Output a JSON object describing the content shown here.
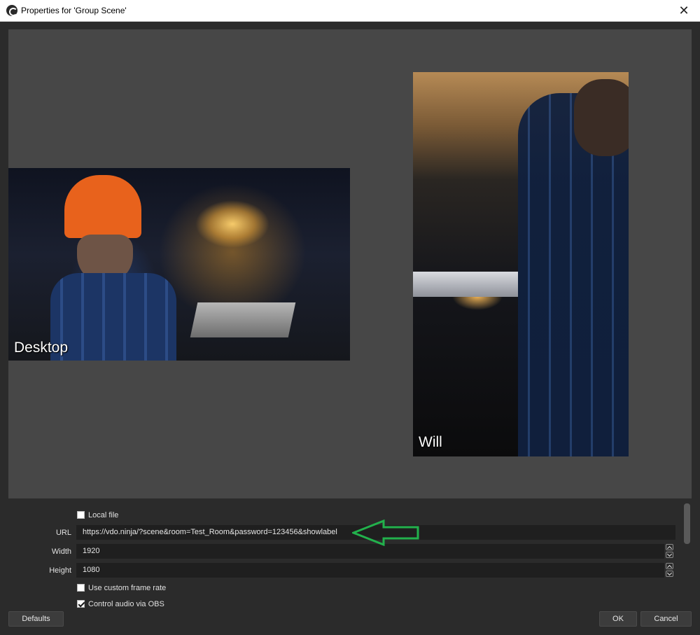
{
  "window": {
    "title": "Properties for 'Group Scene'",
    "close_glyph": "✕"
  },
  "preview": {
    "sources": [
      {
        "label": "Desktop"
      },
      {
        "label": "Will"
      }
    ]
  },
  "properties": {
    "local_file": {
      "label": "Local file",
      "checked": false
    },
    "url": {
      "label": "URL",
      "value": "https://vdo.ninja/?scene&room=Test_Room&password=123456&showlabel"
    },
    "width": {
      "label": "Width",
      "value": "1920"
    },
    "height": {
      "label": "Height",
      "value": "1080"
    },
    "custom_frame_rate": {
      "label": "Use custom frame rate",
      "checked": false
    },
    "control_audio": {
      "label": "Control audio via OBS",
      "checked": true
    }
  },
  "buttons": {
    "defaults": "Defaults",
    "ok": "OK",
    "cancel": "Cancel"
  },
  "annotation": {
    "arrow_color": "#22b14c",
    "icon": "left-arrow-icon"
  },
  "colors": {
    "background": "#2b2b2b",
    "preview_bg": "#474747",
    "field_bg": "#1f1f1f"
  }
}
